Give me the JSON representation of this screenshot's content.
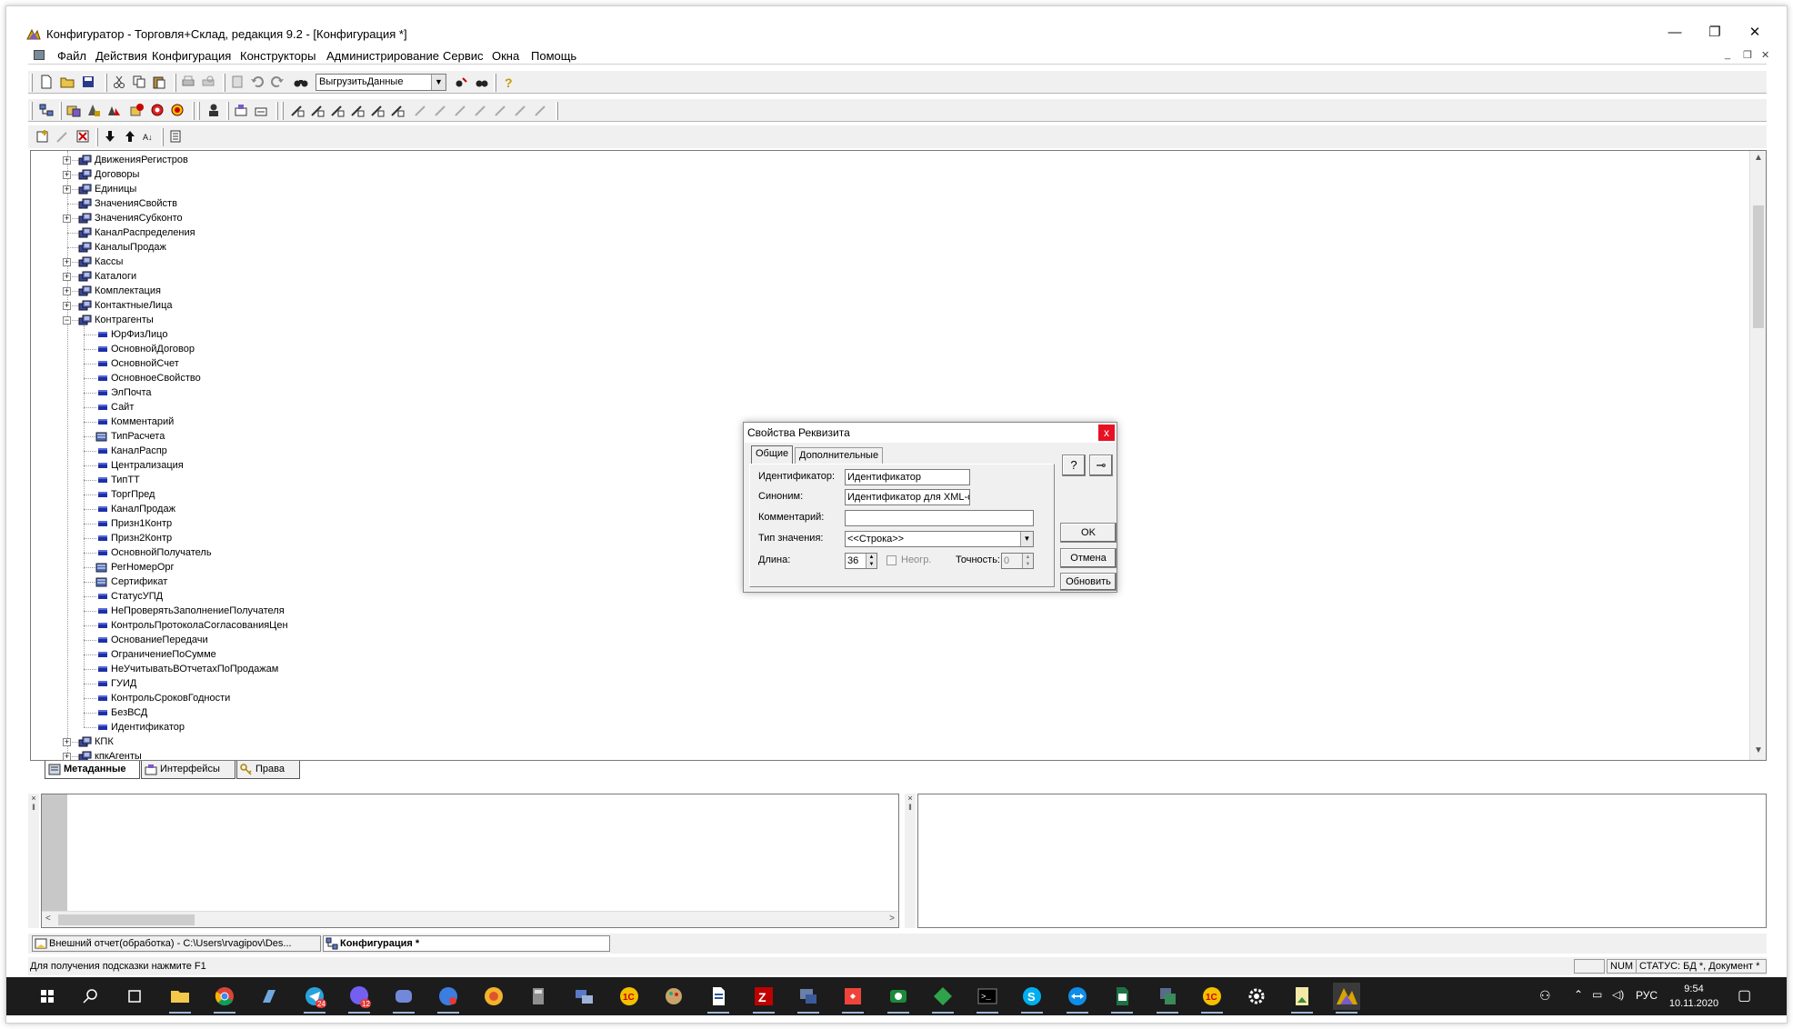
{
  "window": {
    "title": "Конфигуратор - Торговля+Склад, редакция 9.2 - [Конфигурация *]",
    "minimize": "—",
    "restore": "❐",
    "close": "✕"
  },
  "menu": [
    "Файл",
    "Действия",
    "Конфигурация",
    "Конструкторы",
    "Администрирование",
    "Сервис",
    "Окна",
    "Помощь"
  ],
  "mdi_controls": [
    "_",
    "❐",
    "✕"
  ],
  "toolbar": {
    "search_combo_value": "ВыгрузитьДанные",
    "search_combo_arrow": "▼"
  },
  "tree": {
    "nodes": [
      {
        "label": "ДвиженияРегистров",
        "level": 0,
        "expand": "+",
        "icon": "catalog-icon"
      },
      {
        "label": "Договоры",
        "level": 0,
        "expand": "+",
        "icon": "catalog-icon"
      },
      {
        "label": "Единицы",
        "level": 0,
        "expand": "+",
        "icon": "catalog-icon"
      },
      {
        "label": "ЗначенияСвойств",
        "level": 0,
        "expand": "",
        "icon": "catalog-icon"
      },
      {
        "label": "ЗначенияСубконто",
        "level": 0,
        "expand": "+",
        "icon": "catalog-icon"
      },
      {
        "label": "КаналРаспределения",
        "level": 0,
        "expand": "",
        "icon": "catalog-icon"
      },
      {
        "label": "КаналыПродаж",
        "level": 0,
        "expand": "",
        "icon": "catalog-icon"
      },
      {
        "label": "Кассы",
        "level": 0,
        "expand": "+",
        "icon": "catalog-icon"
      },
      {
        "label": "Каталоги",
        "level": 0,
        "expand": "+",
        "icon": "catalog-icon"
      },
      {
        "label": "Комплектация",
        "level": 0,
        "expand": "+",
        "icon": "catalog-icon"
      },
      {
        "label": "КонтактныеЛица",
        "level": 0,
        "expand": "+",
        "icon": "catalog-icon"
      },
      {
        "label": "Контрагенты",
        "level": 0,
        "expand": "−",
        "icon": "catalog-icon"
      },
      {
        "label": "ЮрФизЛицо",
        "level": 1,
        "expand": "",
        "icon": "attribute-icon"
      },
      {
        "label": "ОсновнойДоговор",
        "level": 1,
        "expand": "",
        "icon": "attribute-icon"
      },
      {
        "label": "ОсновнойСчет",
        "level": 1,
        "expand": "",
        "icon": "attribute-icon"
      },
      {
        "label": "ОсновноеСвойство",
        "level": 1,
        "expand": "",
        "icon": "attribute-icon"
      },
      {
        "label": "ЭлПочта",
        "level": 1,
        "expand": "",
        "icon": "attribute-icon"
      },
      {
        "label": "Сайт",
        "level": 1,
        "expand": "",
        "icon": "attribute-icon"
      },
      {
        "label": "Комментарий",
        "level": 1,
        "expand": "",
        "icon": "attribute-icon"
      },
      {
        "label": "ТипРасчета",
        "level": 1,
        "expand": "",
        "icon": "catalog-ref-icon"
      },
      {
        "label": "КаналРаспр",
        "level": 1,
        "expand": "",
        "icon": "attribute-icon"
      },
      {
        "label": "Централизация",
        "level": 1,
        "expand": "",
        "icon": "attribute-icon"
      },
      {
        "label": "ТипТТ",
        "level": 1,
        "expand": "",
        "icon": "attribute-icon"
      },
      {
        "label": "ТоргПред",
        "level": 1,
        "expand": "",
        "icon": "attribute-icon"
      },
      {
        "label": "КаналПродаж",
        "level": 1,
        "expand": "",
        "icon": "attribute-icon"
      },
      {
        "label": "Призн1Контр",
        "level": 1,
        "expand": "",
        "icon": "attribute-icon"
      },
      {
        "label": "Призн2Контр",
        "level": 1,
        "expand": "",
        "icon": "attribute-icon"
      },
      {
        "label": "ОсновнойПолучатель",
        "level": 1,
        "expand": "",
        "icon": "attribute-icon"
      },
      {
        "label": "РегНомерОрг",
        "level": 1,
        "expand": "",
        "icon": "catalog-ref-icon"
      },
      {
        "label": "Сертификат",
        "level": 1,
        "expand": "",
        "icon": "catalog-ref-icon"
      },
      {
        "label": "СтатусУПД",
        "level": 1,
        "expand": "",
        "icon": "attribute-icon"
      },
      {
        "label": "НеПроверятьЗаполнениеПолучателя",
        "level": 1,
        "expand": "",
        "icon": "attribute-icon"
      },
      {
        "label": "КонтрольПротоколаСогласованияЦен",
        "level": 1,
        "expand": "",
        "icon": "attribute-icon"
      },
      {
        "label": "ОснованиеПередачи",
        "level": 1,
        "expand": "",
        "icon": "attribute-icon"
      },
      {
        "label": "ОграничениеПоСумме",
        "level": 1,
        "expand": "",
        "icon": "attribute-icon"
      },
      {
        "label": "НеУчитыватьВОтчетахПоПродажам",
        "level": 1,
        "expand": "",
        "icon": "attribute-icon"
      },
      {
        "label": "ГУИД",
        "level": 1,
        "expand": "",
        "icon": "attribute-icon"
      },
      {
        "label": "КонтрольСроковГодности",
        "level": 1,
        "expand": "",
        "icon": "attribute-icon"
      },
      {
        "label": "БезВСД",
        "level": 1,
        "expand": "",
        "icon": "attribute-icon"
      },
      {
        "label": "Идентификатор",
        "level": 1,
        "expand": "",
        "icon": "attribute-icon"
      },
      {
        "label": "КПК",
        "level": 0,
        "expand": "+",
        "icon": "catalog-icon"
      },
      {
        "label": "кпкАгенты",
        "level": 0,
        "expand": "+",
        "icon": "catalog-icon"
      }
    ]
  },
  "tabs": [
    "Метаданные",
    "Интерфейсы",
    "Права"
  ],
  "dialog": {
    "title": "Свойства Реквизита",
    "close": "x",
    "tabs": [
      "Общие",
      "Дополнительные"
    ],
    "fields": {
      "identifier_label": "Идентификатор:",
      "identifier_value": "Идентификатор",
      "synonym_label": "Синоним:",
      "synonym_value": "Идентификатор для XML-о",
      "comment_label": "Комментарий:",
      "comment_value": "",
      "type_label": "Тип значения:",
      "type_value": "<<Строка>>",
      "length_label": "Длина:",
      "length_value": "36",
      "unlimited_label": "Неогр.",
      "precision_label": "Точность:",
      "precision_value": "0"
    },
    "buttons": {
      "ok": "OK",
      "cancel": "Отмена",
      "refresh": "Обновить",
      "help": "?",
      "pin": "⊸"
    }
  },
  "window_strip": [
    {
      "label": "Внешний отчет(обработка) - C:\\Users\\rvagipov\\Des...",
      "active": false
    },
    {
      "label": "Конфигурация *",
      "active": true
    }
  ],
  "status": {
    "hint": "Для получения подсказки нажмите F1",
    "num": "NUM",
    "state": "СТАТУС: БД *, Документ *"
  },
  "taskbar": {
    "lang": "РУС",
    "time": "9:54",
    "date": "10.11.2020",
    "badges": {
      "telegram": "24",
      "viber": "12"
    }
  },
  "colors": {
    "attr_blue": "#1f2fa8",
    "taskbar_bg": "#1c1c1c",
    "dialog_close": "#e81123",
    "accent_1c": "#f3c000"
  }
}
